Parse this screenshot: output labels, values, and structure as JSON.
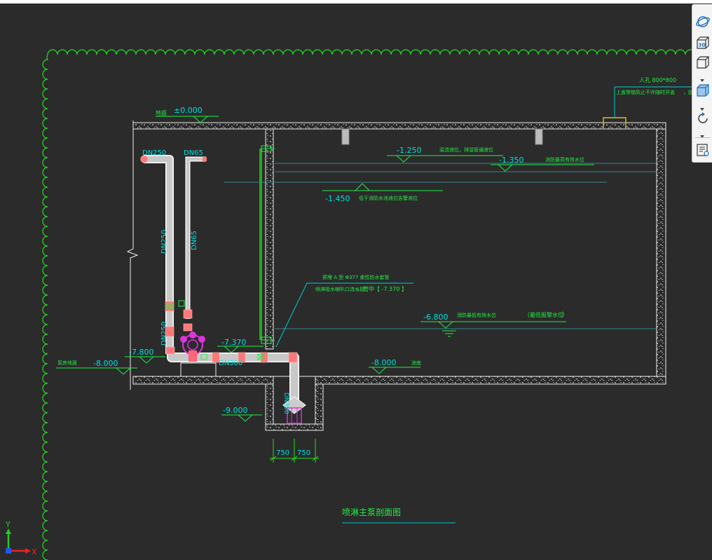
{
  "colors": {
    "background": "#2b2b2b",
    "cloud": "#22dd22",
    "dimension": "#22dd22",
    "level_text": "#00e0e0",
    "note_text": "#22ee44",
    "leader": "#00cccc",
    "wall": "#eeeeee",
    "pipe_fill": "#c8c8c8",
    "pipe_edge": "#ffffff",
    "fitting": "#ff7777",
    "pump": "#dd33dd",
    "water_line": "#3aa7b0",
    "column": "#bbbbbb",
    "drain_pipe": "#22aa22",
    "title_underline": "#00cccc",
    "ucs_y": "#22cc22",
    "ucs_x": "#ee2222",
    "manhole": "#e0c020"
  },
  "drawing": {
    "elevations": {
      "ground_zero": "±0.000",
      "ground_label": "地面",
      "overflow_level": "-1.250",
      "overflow_note": "溢流液位，排溢管通液位",
      "fire_level": "-1.350",
      "fire_note": "消防最高有效水位",
      "low_level": "-1.450",
      "low_note": "低于消防水池液位告警液位",
      "water_level": "-6.800",
      "water_note": "消防最低有效水位",
      "water_note2": "（最低报警水位",
      "water_note2_close": "）",
      "pipe_level": "-7.370",
      "pump_level": "-7.800",
      "pumproom_floor": "-8.000",
      "pumproom_label": "泵房地面",
      "pool_floor": "-8.000",
      "pool_floor_label": "池底",
      "sump_floor": "-9.000"
    },
    "manhole": {
      "line1": "人孔  800*800",
      "line2": "上盖带锁防止不许随时开盖",
      "line3": "，固锁"
    },
    "pipe_callout": {
      "line1": "预埋  A  型  Φ377    柔性防水套管",
      "line2": "喷淋吸水喇叭口流水管",
      "line3": "，管中【   -7.370    】"
    },
    "pipes": {
      "dn250_top": "DN250",
      "dn65_top": "DN65",
      "dn250_vertical": "DN250",
      "dn65_vertical": "DN65",
      "dn250_lower": "DN250",
      "dn300_horizontal": "DN300",
      "dn300_vertical": "DN300"
    },
    "dimensions": {
      "left": "750",
      "right": "750"
    },
    "title": "喷淋主泵剖面图"
  },
  "ucs": {
    "x_label": "X",
    "y_label": "Y"
  },
  "view_toolbar": {
    "tools": [
      {
        "icon": "orbit-icon"
      },
      {
        "icon": "view-3d-icon",
        "label": "3D"
      },
      {
        "icon": "wireframe-cube-icon"
      },
      {
        "icon": "shaded-cube-icon"
      },
      {
        "icon": "rotate-icon"
      },
      {
        "icon": "properties-list-icon"
      }
    ]
  }
}
